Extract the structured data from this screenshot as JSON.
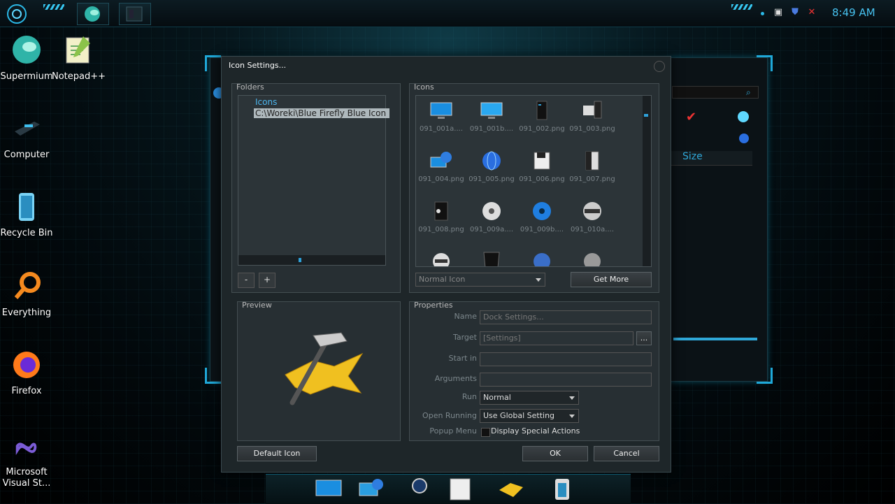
{
  "taskbar": {
    "clock": "8:49 AM"
  },
  "desktop_icons": [
    {
      "label": "Supermium",
      "icon": "supermium-icon"
    },
    {
      "label": "Notepad++",
      "icon": "notepadpp-icon"
    },
    {
      "label": "Computer",
      "icon": "computer-icon"
    },
    {
      "label": "Recycle Bin",
      "icon": "recycle-bin-icon"
    },
    {
      "label": "Everything",
      "icon": "everything-icon"
    },
    {
      "label": "Firefox",
      "icon": "firefox-icon"
    },
    {
      "label": "Microsoft Visual St...",
      "icon": "visual-studio-icon"
    }
  ],
  "background_window": {
    "column_size": "Size"
  },
  "dialog": {
    "title": "Icon Settings...",
    "folders": {
      "label": "Folders",
      "tree_root": "Icons",
      "tree_child": "C:\\Woreki\\Blue Firefly Blue Icon",
      "remove": "-",
      "add": "+"
    },
    "icons": {
      "label": "Icons",
      "files": [
        "091_001a....",
        "091_001b....",
        "091_002.png",
        "091_003.png",
        "091_004.png",
        "091_005.png",
        "091_006.png",
        "091_007.png",
        "091_008.png",
        "091_009a....",
        "091_009b....",
        "091_010a...."
      ],
      "state_select": "Normal Icon",
      "get_more": "Get More"
    },
    "preview": {
      "label": "Preview"
    },
    "properties": {
      "label": "Properties",
      "name_label": "Name",
      "name_value": "Dock Settings...",
      "target_label": "Target",
      "target_value": "[Settings]",
      "browse": "...",
      "startin_label": "Start in",
      "startin_value": "",
      "arguments_label": "Arguments",
      "arguments_value": "",
      "run_label": "Run",
      "run_value": "Normal",
      "openrunning_label": "Open Running",
      "openrunning_value": "Use Global Setting",
      "popup_label": "Popup Menu",
      "popup_check_label": "Display Special Actions"
    },
    "buttons": {
      "default_icon": "Default Icon",
      "ok": "OK",
      "cancel": "Cancel"
    }
  }
}
